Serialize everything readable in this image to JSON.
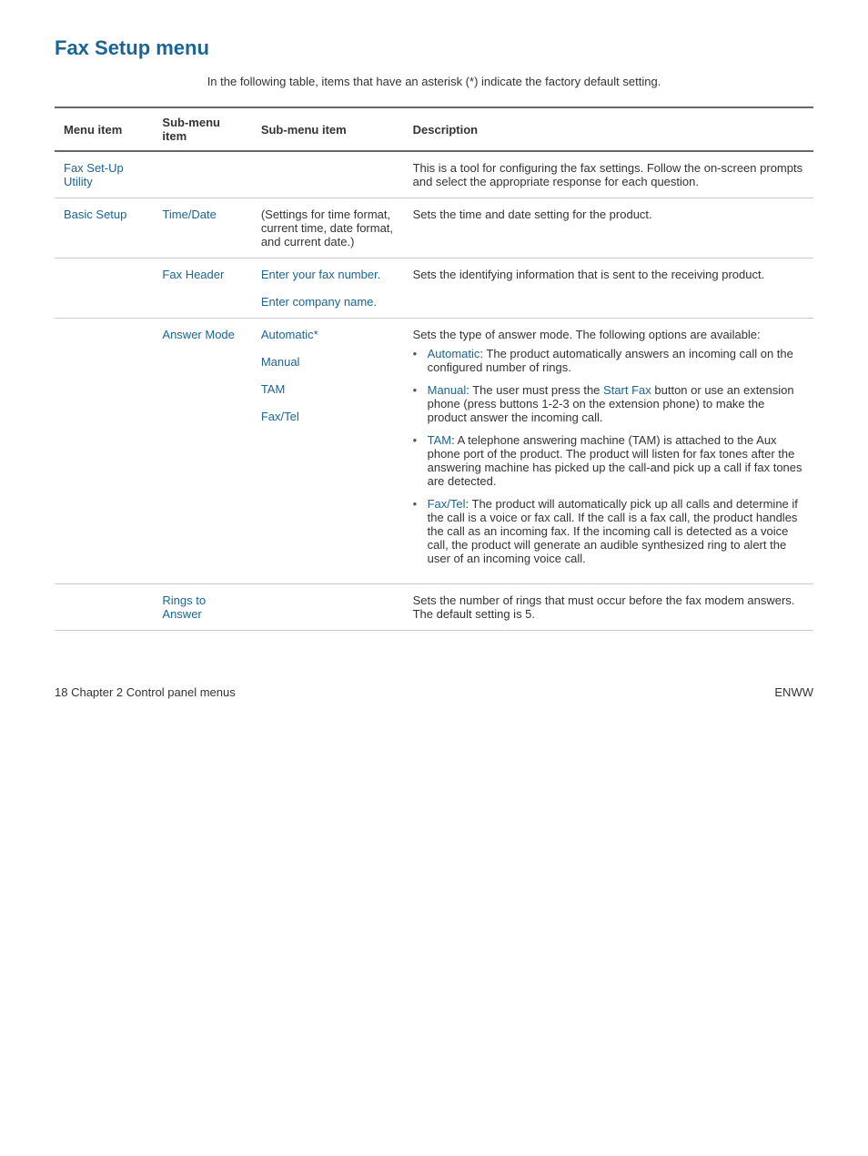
{
  "page": {
    "title": "Fax Setup menu",
    "subtitle": "In the following table, items that have an asterisk (*) indicate the factory default setting.",
    "footer_left": "18     Chapter 2   Control panel menus",
    "footer_right": "ENWW"
  },
  "table": {
    "headers": [
      "Menu item",
      "Sub-menu item",
      "Sub-menu item",
      "Description"
    ],
    "rows": [
      {
        "menu": "Fax Set-Up Utility",
        "sub1": "",
        "sub2": "",
        "description": "This is a tool for configuring the fax settings. Follow the on-screen prompts and select the appropriate response for each question."
      },
      {
        "menu": "Basic Setup",
        "sub1": "Time/Date",
        "sub2": "(Settings for time format, current time, date format, and current date.)",
        "description": "Sets the time and date setting for the product."
      },
      {
        "menu": "",
        "sub1": "Fax Header",
        "sub2": "Enter your fax number.\n\nEnter company name.",
        "description": "Sets the identifying information that is sent to the receiving product."
      },
      {
        "menu": "",
        "sub1": "Answer Mode",
        "sub2": "Automatic*\n\nManual\n\nTAM\n\nFax/Tel",
        "description": "Sets the type of answer mode. The following options are available:"
      },
      {
        "menu": "",
        "sub1": "Rings to Answer",
        "sub2": "",
        "description": "Sets the number of rings that must occur before the fax modem answers. The default setting is 5."
      }
    ],
    "answer_mode_bullets": [
      {
        "label": "Automatic",
        "text": ": The product automatically answers an incoming call on the configured number of rings."
      },
      {
        "label": "Manual",
        "text": ": The user must press the Start Fax button or use an extension phone (press buttons 1-2-3 on the extension phone) to make the product answer the incoming call."
      },
      {
        "label": "TAM",
        "text": ": A telephone answering machine (TAM) is attached to the Aux phone port of the product. The product will listen for fax tones after the answering machine has picked up the call-and pick up a call if fax tones are detected."
      },
      {
        "label": "Fax/Tel",
        "text": ": The product will automatically pick up all calls and determine if the call is a voice or fax call. If the call is a fax call, the product handles the call as an incoming fax. If the incoming call is detected as a voice call, the product will generate an audible synthesized ring to alert the user of an incoming voice call."
      }
    ]
  }
}
